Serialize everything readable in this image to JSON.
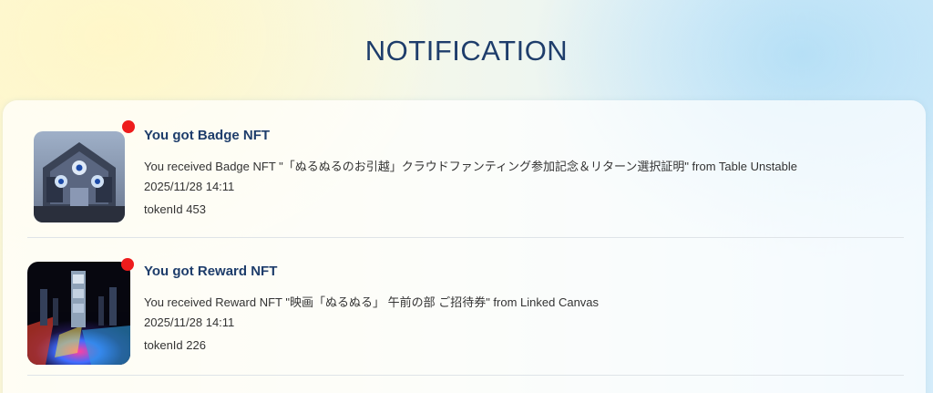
{
  "page": {
    "title": "NOTIFICATION"
  },
  "notifications": [
    {
      "title": "You got Badge NFT",
      "message": "You received Badge NFT \"「ぬるぬるのお引越」クラウドファンティング参加記念＆リターン選択証明\" from Table Unstable",
      "timestamp": "2025/11/28 14:11",
      "token": "tokenId 453",
      "unread": true
    },
    {
      "title": "You got Reward NFT",
      "message": "You received Reward NFT \"映画「ぬるぬる」 午前の部 ご招待券\" from Linked Canvas",
      "timestamp": "2025/11/28 14:11",
      "token": "tokenId 226",
      "unread": true
    }
  ],
  "colors": {
    "title": "#1e3d6b",
    "unread_dot": "#ee1c1c",
    "body_text": "#333333"
  }
}
